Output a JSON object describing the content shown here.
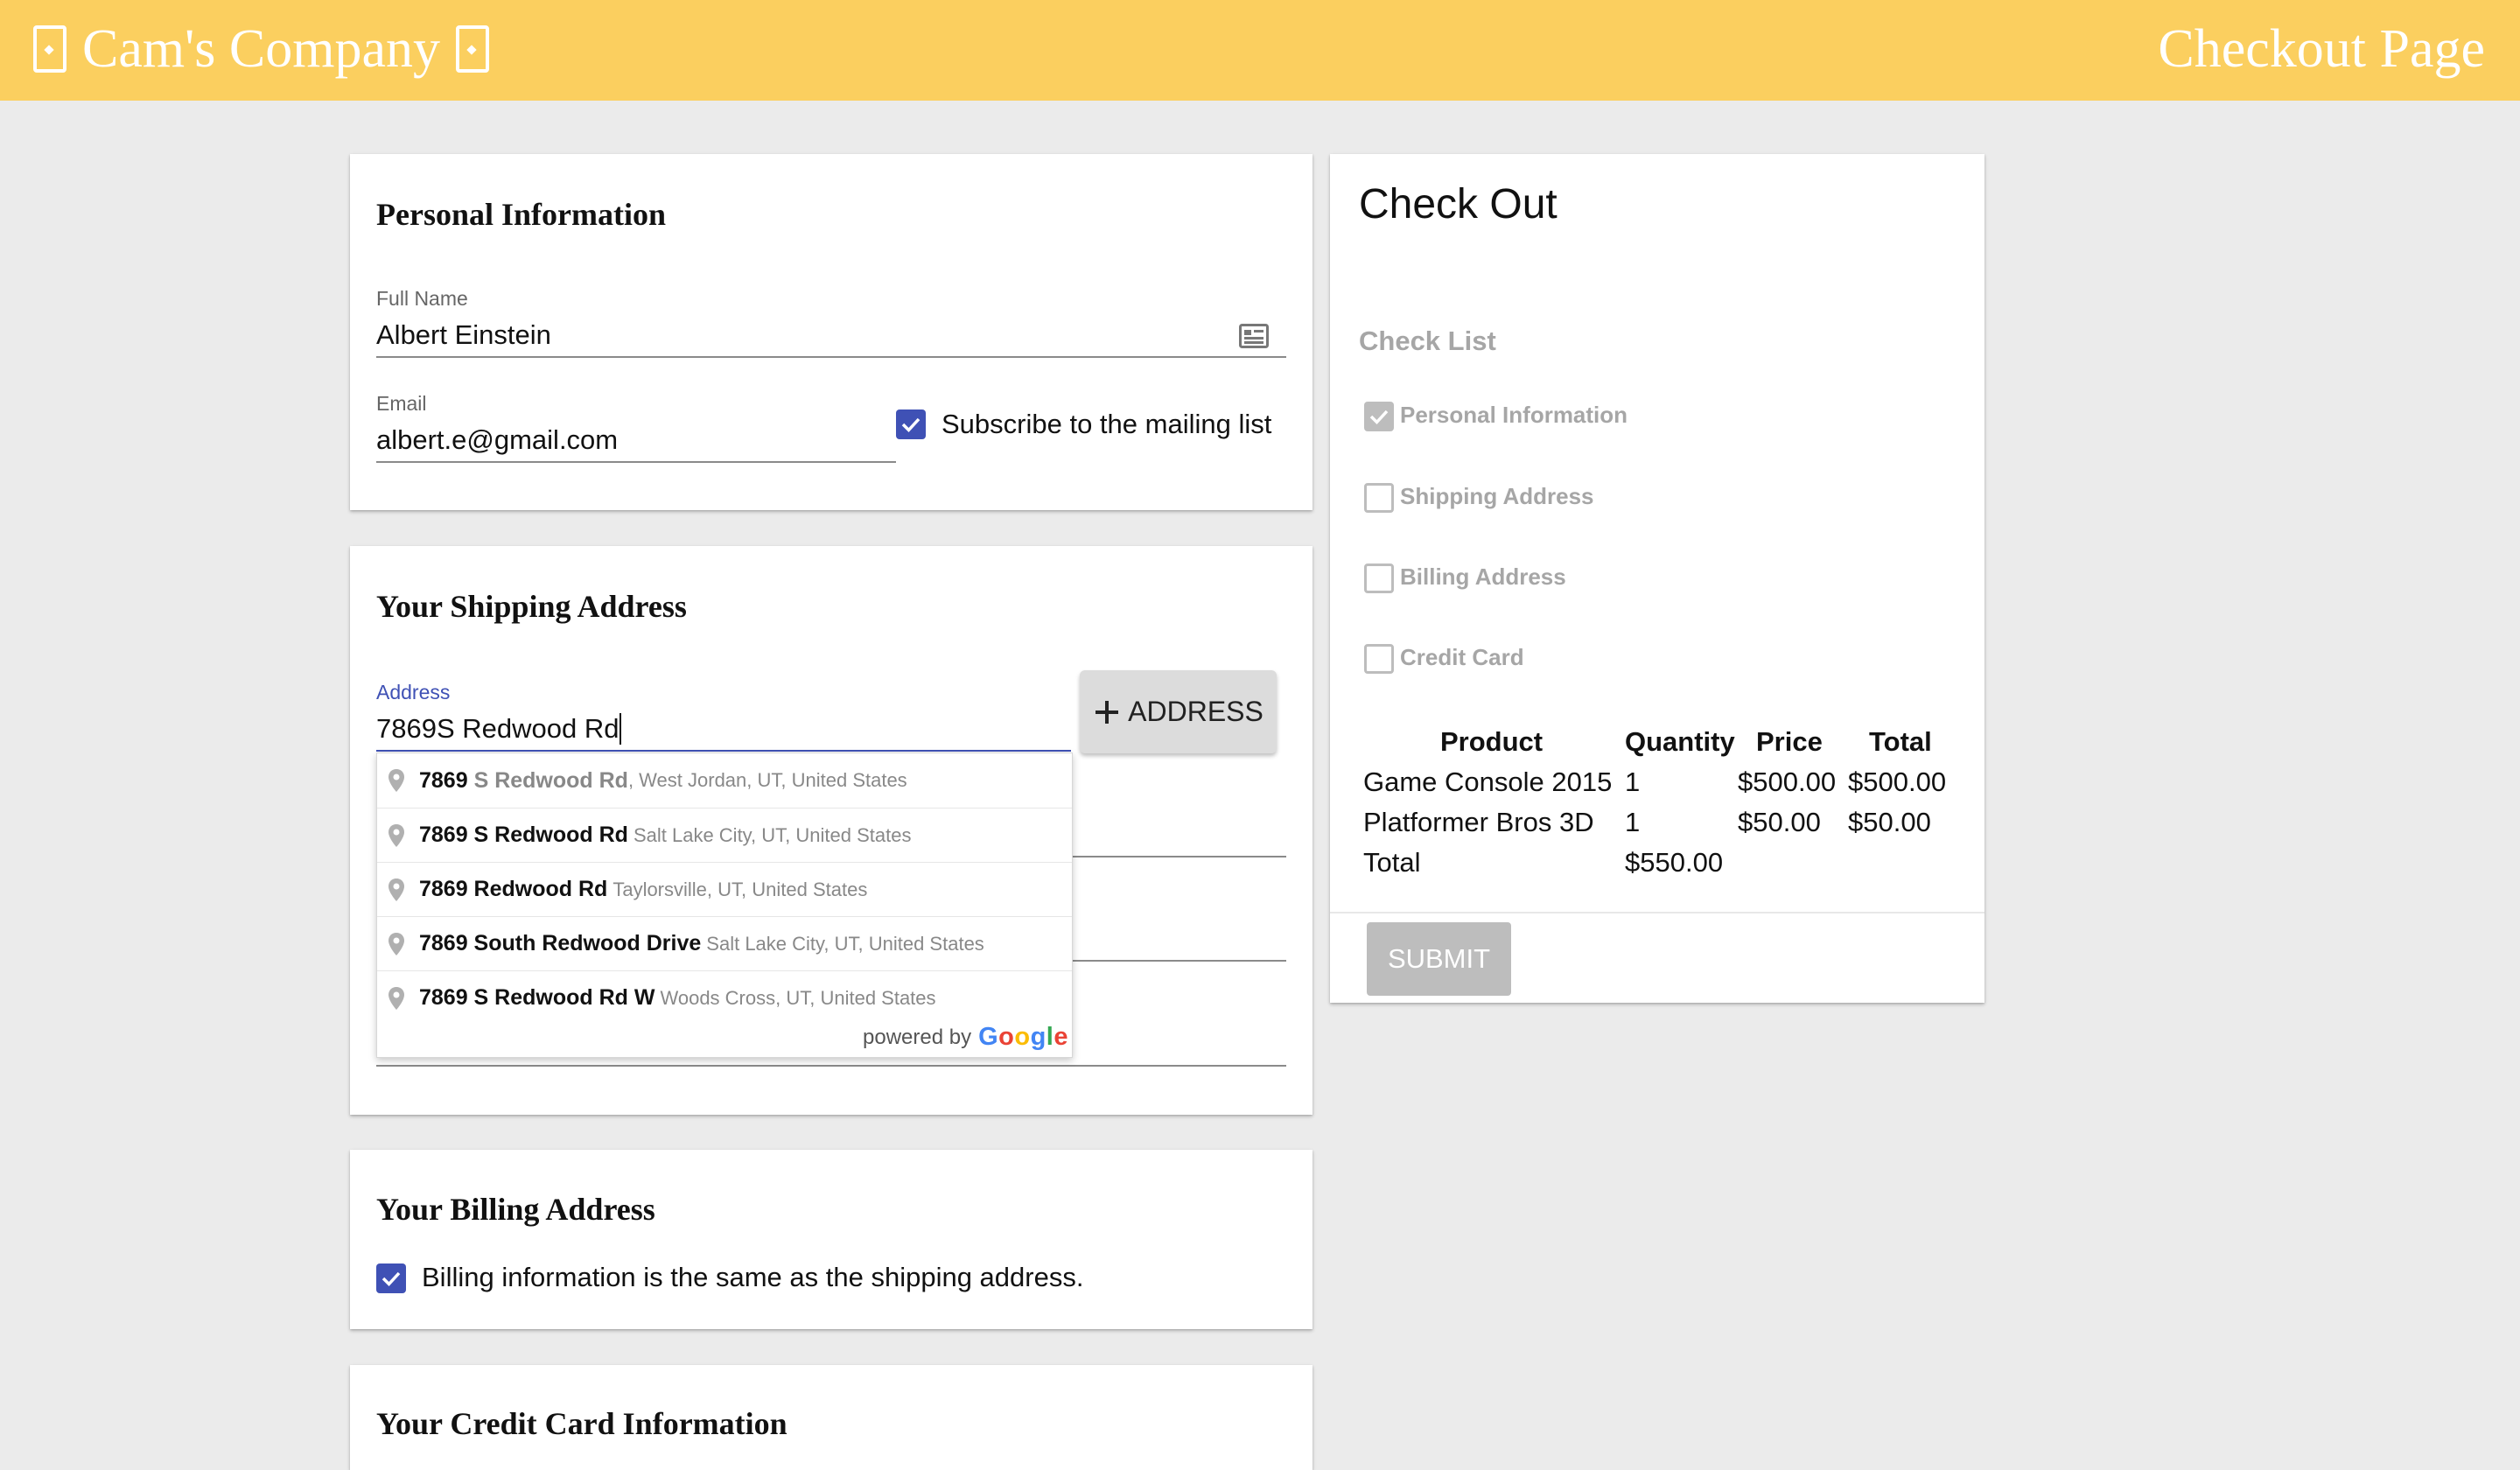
{
  "header": {
    "brand": "Cam's Company",
    "page_title": "Checkout Page"
  },
  "personal": {
    "title": "Personal Information",
    "full_name_label": "Full Name",
    "full_name_value": "Albert Einstein",
    "email_label": "Email",
    "email_value": "albert.e@gmail.com",
    "subscribe_label": "Subscribe to the mailing list",
    "subscribe_checked": true
  },
  "shipping": {
    "title": "Your Shipping Address",
    "address_label": "Address",
    "address_value": "7869S Redwood Rd",
    "add_address_button": "ADDRESS",
    "suggestions": [
      {
        "match": "7869",
        "rest": " S Redwood Rd",
        "secondary": ", West Jordan, UT, United States"
      },
      {
        "match": "7869 S Redwood Rd",
        "rest": "",
        "secondary": "Salt Lake City, UT, United States"
      },
      {
        "match": "7869 Redwood Rd",
        "rest": "",
        "secondary": "Taylorsville, UT, United States"
      },
      {
        "match": "7869 South Redwood Drive",
        "rest": "",
        "secondary": "Salt Lake City, UT, United States"
      },
      {
        "match": "7869 S Redwood Rd W",
        "rest": "",
        "secondary": "Woods Cross, UT, United States"
      }
    ],
    "powered_by": "powered by",
    "powered_brand": "Google"
  },
  "billing": {
    "title": "Your Billing Address",
    "same_label": "Billing information is the same as the shipping address.",
    "same_checked": true
  },
  "credit": {
    "title": "Your Credit Card Information"
  },
  "checkout": {
    "title": "Check Out",
    "checklist_title": "Check List",
    "checklist": [
      {
        "label": "Personal Information",
        "checked": true
      },
      {
        "label": "Shipping Address",
        "checked": false
      },
      {
        "label": "Billing Address",
        "checked": false
      },
      {
        "label": "Credit Card",
        "checked": false
      }
    ],
    "table": {
      "headers": [
        "Product",
        "Quantity",
        "Price",
        "Total"
      ],
      "rows": [
        [
          "Game Console 2015",
          "1",
          "$500.00",
          "$500.00"
        ],
        [
          "Platformer Bros 3D",
          "1",
          "$50.00",
          "$50.00"
        ]
      ],
      "total_label": "Total",
      "total_value": "$550.00"
    },
    "submit_label": "SUBMIT"
  },
  "colors": {
    "header_bg": "#fbcf5f",
    "page_bg": "#ebebeb",
    "checkbox": "#3f51b5",
    "disabled": "#bdbdbd"
  }
}
